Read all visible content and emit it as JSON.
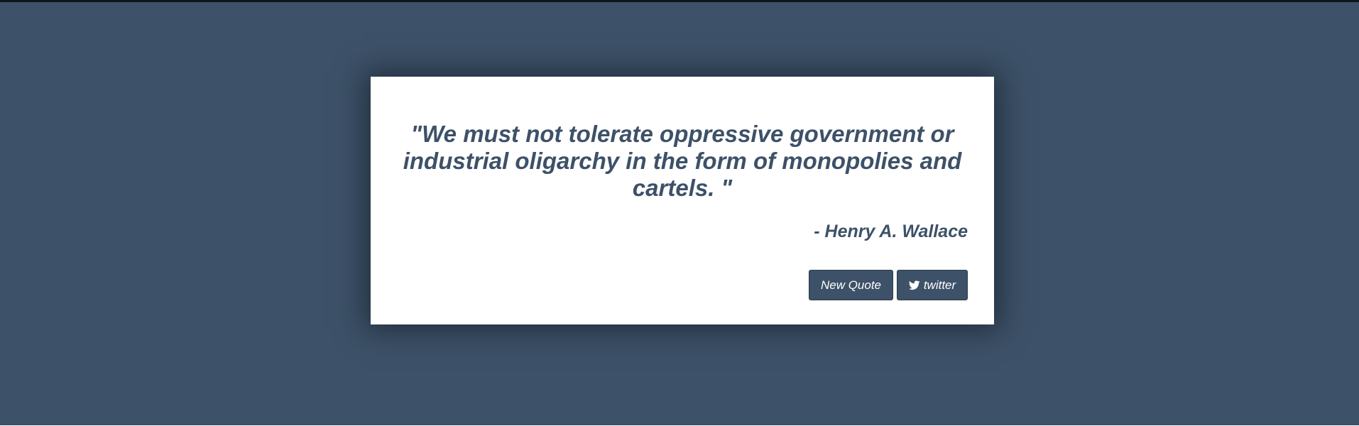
{
  "quote": {
    "text": "\"We must not tolerate oppressive government or industrial oligarchy in the form of monopolies and cartels. \"",
    "author": "- Henry A. Wallace"
  },
  "buttons": {
    "new_quote_label": "New Quote",
    "twitter_label": "twitter",
    "twitter_icon": "twitter-bird-icon"
  },
  "colors": {
    "background": "#3d5168",
    "card": "#ffffff",
    "accent": "#3d5168",
    "button_text": "#ffffff"
  }
}
